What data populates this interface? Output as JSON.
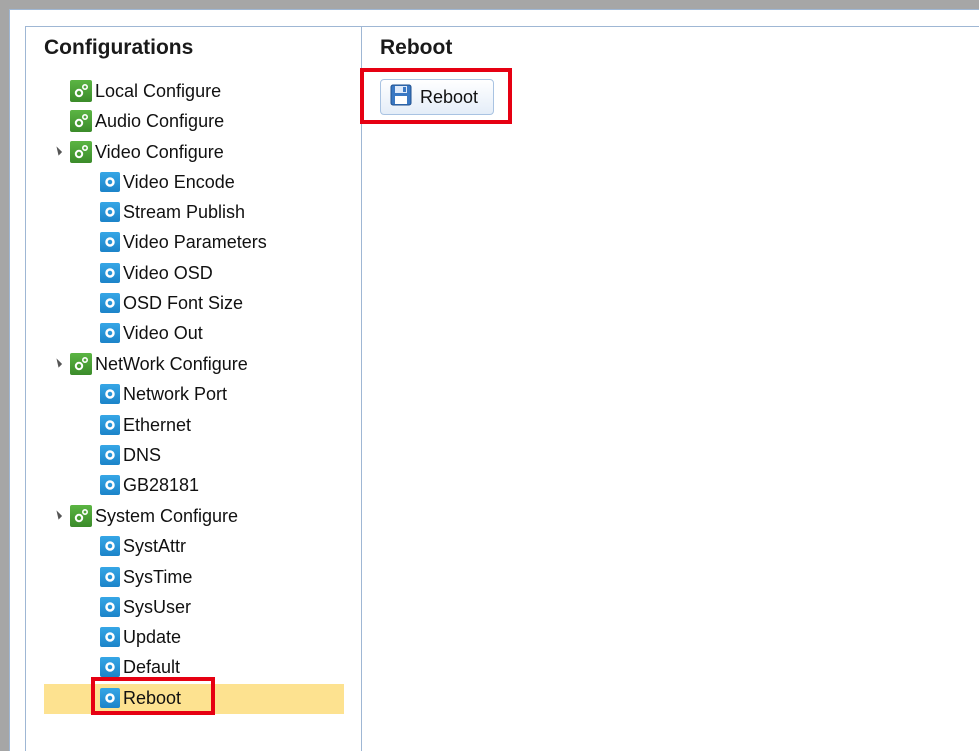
{
  "sidebar": {
    "title": "Configurations",
    "items": [
      {
        "label": "Local Configure",
        "icon": "gear-group-icon"
      },
      {
        "label": "Audio Configure",
        "icon": "gear-group-icon"
      },
      {
        "label": "Video Configure",
        "icon": "gear-group-icon",
        "expanded": true
      },
      {
        "label": "Video Encode",
        "icon": "gear-icon"
      },
      {
        "label": "Stream Publish",
        "icon": "gear-icon"
      },
      {
        "label": "Video Parameters",
        "icon": "gear-icon"
      },
      {
        "label": "Video OSD",
        "icon": "gear-icon"
      },
      {
        "label": "OSD Font Size",
        "icon": "gear-icon"
      },
      {
        "label": "Video Out",
        "icon": "gear-icon"
      },
      {
        "label": "NetWork Configure",
        "icon": "gear-group-icon",
        "expanded": true
      },
      {
        "label": "Network Port",
        "icon": "gear-icon"
      },
      {
        "label": "Ethernet",
        "icon": "gear-icon"
      },
      {
        "label": "DNS",
        "icon": "gear-icon"
      },
      {
        "label": "GB28181",
        "icon": "gear-icon"
      },
      {
        "label": "System Configure",
        "icon": "gear-group-icon",
        "expanded": true
      },
      {
        "label": "SystAttr",
        "icon": "gear-icon"
      },
      {
        "label": "SysTime",
        "icon": "gear-icon"
      },
      {
        "label": "SysUser",
        "icon": "gear-icon"
      },
      {
        "label": "Update",
        "icon": "gear-icon"
      },
      {
        "label": "Default",
        "icon": "gear-icon"
      },
      {
        "label": "Reboot",
        "icon": "gear-icon",
        "selected": true
      }
    ]
  },
  "content": {
    "title": "Reboot",
    "reboot_button_label": "Reboot",
    "reboot_button_icon": "save-icon"
  },
  "colors": {
    "selected_bg": "#fde290",
    "highlight_box": "#e60012",
    "border": "#9fb7d4"
  }
}
